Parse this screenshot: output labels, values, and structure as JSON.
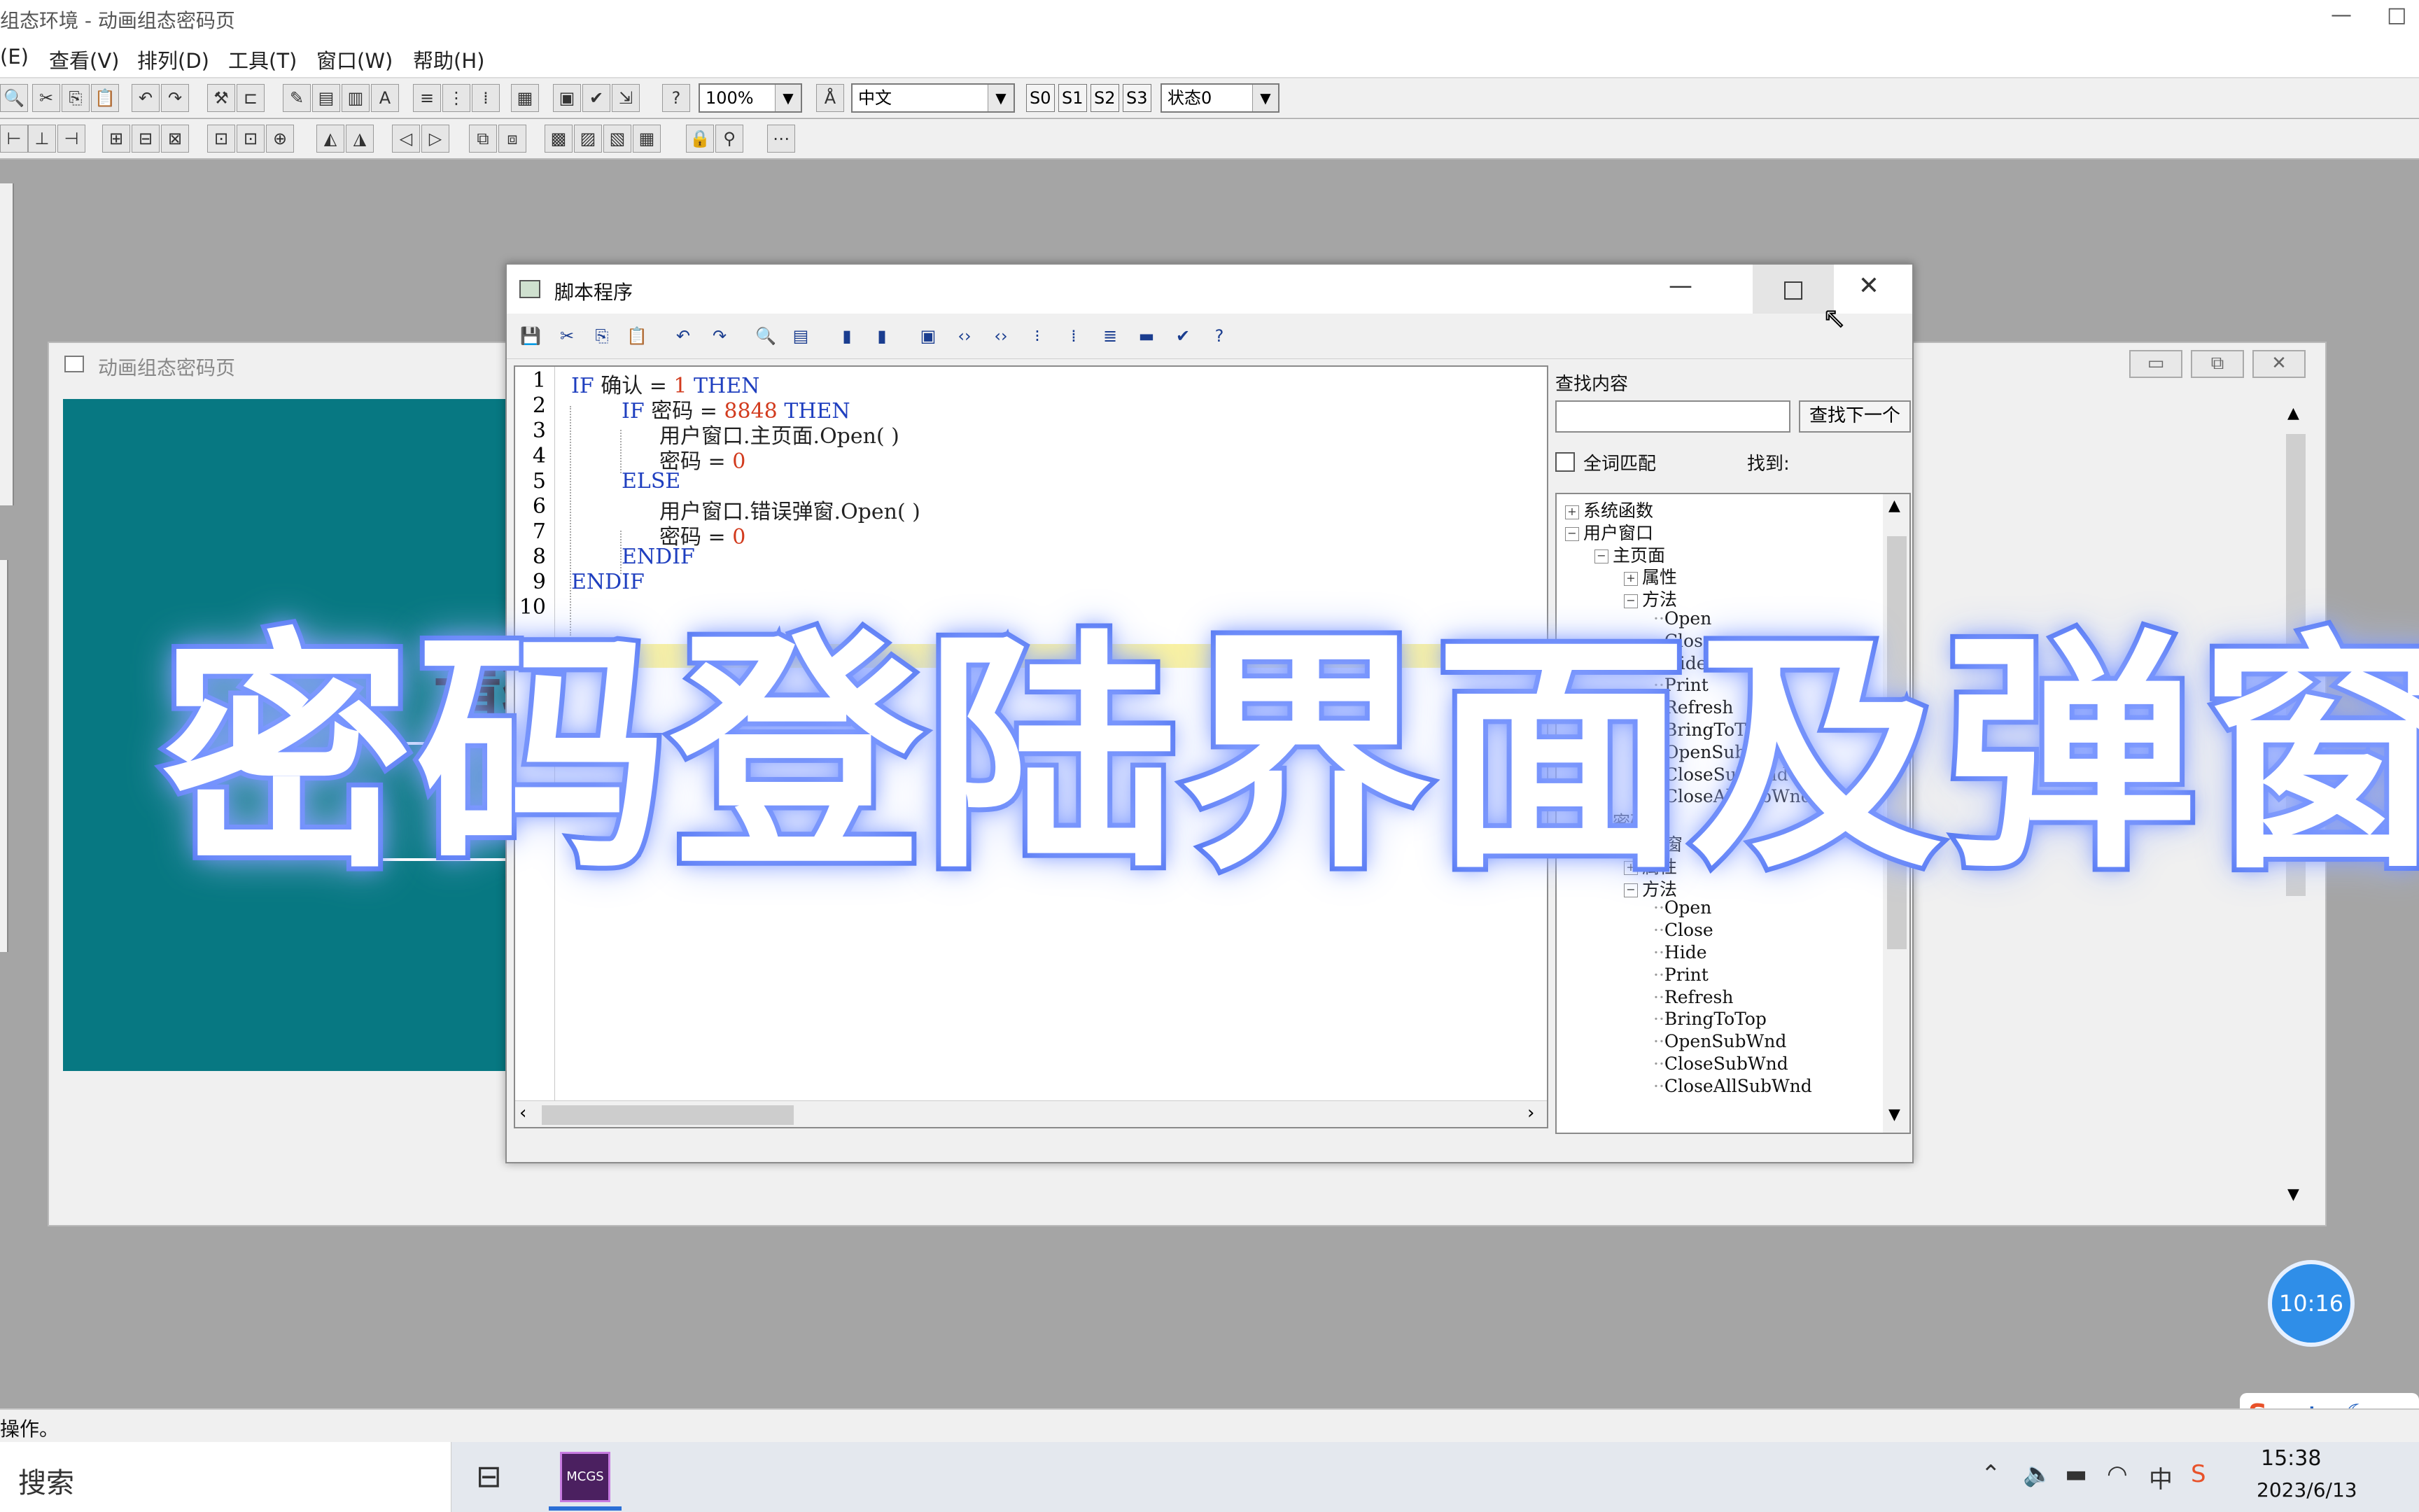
{
  "app": {
    "title": "组态环境 - 动画组态密码页",
    "minimize_glyph": "—",
    "maximize_glyph": "□"
  },
  "menu": [
    "(E)",
    "查看(V)",
    "排列(D)",
    "工具(T)",
    "窗口(W)",
    "帮助(H)"
  ],
  "toolbar": {
    "zoom": "100%",
    "language": "中文",
    "states": [
      "S0",
      "S1",
      "S2",
      "S3"
    ],
    "state_select": "状态0"
  },
  "doc_window": {
    "title": "动画组态密码页",
    "canvas_text": "请输",
    "canvas_color": "#077882"
  },
  "script_window": {
    "title": "脚本程序",
    "code_lines": [
      {
        "no": "1",
        "parts": [
          [
            "kw",
            "IF "
          ],
          [
            "txt",
            "确认 = "
          ],
          [
            "num",
            "1"
          ],
          [
            "kw",
            " THEN"
          ]
        ]
      },
      {
        "no": "2",
        "parts": [
          [
            "kw",
            "IF "
          ],
          [
            "txt",
            "密码 = "
          ],
          [
            "num",
            "8848"
          ],
          [
            "kw",
            " THEN"
          ]
        ]
      },
      {
        "no": "3",
        "parts": [
          [
            "txt",
            "用户窗口.主页面.Open( )"
          ]
        ]
      },
      {
        "no": "4",
        "parts": [
          [
            "txt",
            "密码 = "
          ],
          [
            "num",
            "0"
          ]
        ]
      },
      {
        "no": "5",
        "parts": [
          [
            "kw",
            "ELSE"
          ]
        ]
      },
      {
        "no": "6",
        "parts": [
          [
            "txt",
            "用户窗口.错误弹窗.Open( )"
          ]
        ]
      },
      {
        "no": "7",
        "parts": [
          [
            "txt",
            "密码 = "
          ],
          [
            "num",
            "0"
          ]
        ]
      },
      {
        "no": "8",
        "parts": [
          [
            "kw",
            "ENDIF"
          ]
        ]
      },
      {
        "no": "9",
        "parts": [
          [
            "kw",
            "ENDIF"
          ]
        ]
      },
      {
        "no": "10",
        "parts": []
      }
    ],
    "search": {
      "label": "查找内容",
      "value": "",
      "find_next": "查找下一个",
      "whole_word": "全词匹配",
      "found": "找到:"
    },
    "tree": [
      {
        "label": "系统函数",
        "exp": "+",
        "level": 0
      },
      {
        "label": "用户窗口",
        "exp": "−",
        "level": 0
      },
      {
        "label": "主页面",
        "exp": "−",
        "level": 1
      },
      {
        "label": "属性",
        "exp": "+",
        "level": 2
      },
      {
        "label": "方法",
        "exp": "−",
        "level": 2
      },
      {
        "label": "Open",
        "exp": "",
        "level": 3
      },
      {
        "label": "Close",
        "exp": "",
        "level": 3
      },
      {
        "label": "Hide",
        "exp": "",
        "level": 3
      },
      {
        "label": "Print",
        "exp": "",
        "level": 3
      },
      {
        "label": "Refresh",
        "exp": "",
        "level": 3
      },
      {
        "label": "BringToTop",
        "exp": "",
        "level": 3
      },
      {
        "label": "OpenSubWnd",
        "exp": "",
        "level": 3
      },
      {
        "label": "CloseSubWnd",
        "exp": "",
        "level": 3
      },
      {
        "label": "CloseAllSubWnd",
        "exp": "",
        "level": 3
      },
      {
        "label": "密码页",
        "exp": "+",
        "level": 1
      },
      {
        "label": "错误弹窗",
        "exp": "−",
        "level": 1
      },
      {
        "label": "属性",
        "exp": "+",
        "level": 2
      },
      {
        "label": "方法",
        "exp": "−",
        "level": 2
      },
      {
        "label": "Open",
        "exp": "",
        "level": 3
      },
      {
        "label": "Close",
        "exp": "",
        "level": 3
      },
      {
        "label": "Hide",
        "exp": "",
        "level": 3
      },
      {
        "label": "Print",
        "exp": "",
        "level": 3
      },
      {
        "label": "Refresh",
        "exp": "",
        "level": 3
      },
      {
        "label": "BringToTop",
        "exp": "",
        "level": 3
      },
      {
        "label": "OpenSubWnd",
        "exp": "",
        "level": 3
      },
      {
        "label": "CloseSubWnd",
        "exp": "",
        "level": 3
      },
      {
        "label": "CloseAllSubWnd",
        "exp": "",
        "level": 3
      }
    ]
  },
  "overlay_caption": "密码登陆界面及弹窗",
  "timer": "10:16",
  "status_text": "操作。",
  "taskbar": {
    "search_placeholder": "搜索",
    "app_label": "MCGS",
    "clock_time": "15:38",
    "clock_date": "2023/6/13",
    "ime": [
      "S",
      "中"
    ]
  }
}
